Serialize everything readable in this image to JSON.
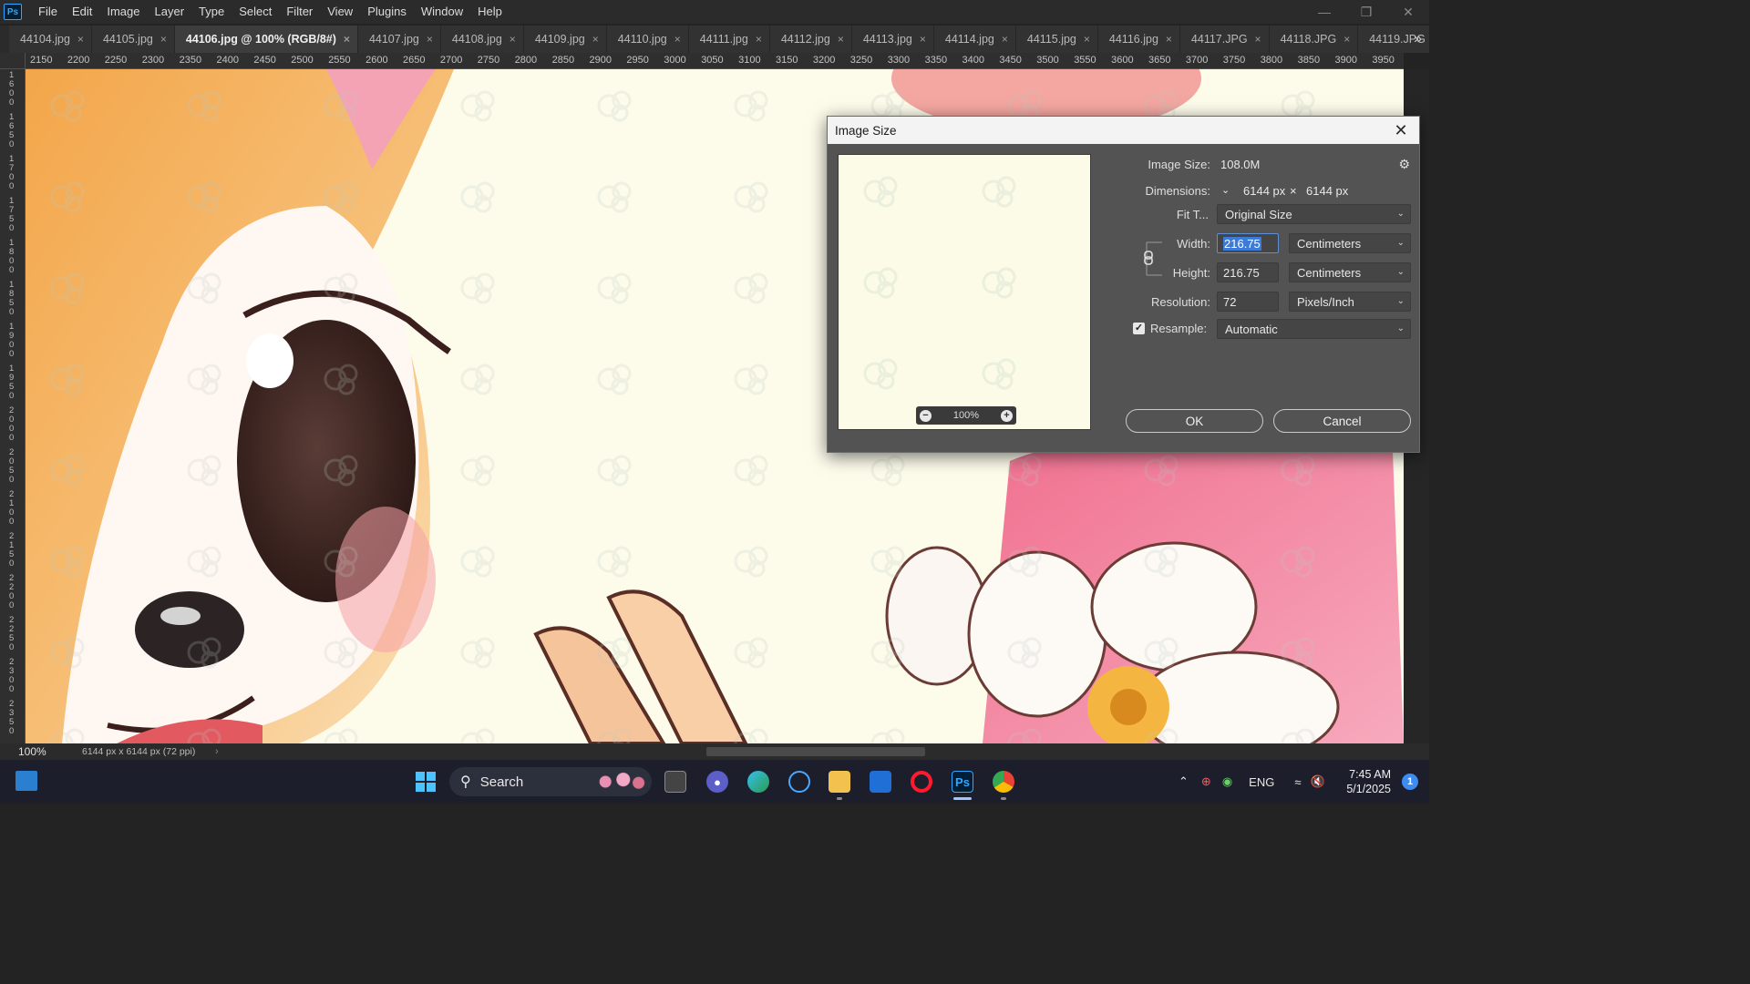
{
  "app": {
    "logo": "Ps"
  },
  "menu": [
    "File",
    "Edit",
    "Image",
    "Layer",
    "Type",
    "Select",
    "Filter",
    "View",
    "Plugins",
    "Window",
    "Help"
  ],
  "window_controls": {
    "minimize": "—",
    "restore": "❐",
    "close": "✕"
  },
  "tabs": [
    {
      "label": "44104.jpg",
      "active": false
    },
    {
      "label": "44105.jpg",
      "active": false
    },
    {
      "label": "44106.jpg @ 100% (RGB/8#)",
      "active": true
    },
    {
      "label": "44107.jpg",
      "active": false
    },
    {
      "label": "44108.jpg",
      "active": false
    },
    {
      "label": "44109.jpg",
      "active": false
    },
    {
      "label": "44110.jpg",
      "active": false
    },
    {
      "label": "44111.jpg",
      "active": false
    },
    {
      "label": "44112.jpg",
      "active": false
    },
    {
      "label": "44113.jpg",
      "active": false
    },
    {
      "label": "44114.jpg",
      "active": false
    },
    {
      "label": "44115.jpg",
      "active": false
    },
    {
      "label": "44116.jpg",
      "active": false
    },
    {
      "label": "44117.JPG",
      "active": false
    },
    {
      "label": "44118.JPG",
      "active": false
    },
    {
      "label": "44119.JPG",
      "active": false
    }
  ],
  "tab_close_glyph": "×",
  "tab_overflow_glyph": "»",
  "ruler_top": [
    "2150",
    "2200",
    "2250",
    "2300",
    "2350",
    "2400",
    "2450",
    "2500",
    "2550",
    "2600",
    "2650",
    "2700",
    "2750",
    "2800",
    "2850",
    "2900",
    "2950",
    "3000",
    "3050",
    "3100",
    "3150",
    "3200",
    "3250",
    "3300",
    "3350",
    "3400",
    "3450",
    "3500",
    "3550",
    "3600",
    "3650",
    "3700",
    "3750",
    "3800",
    "3850",
    "3900",
    "3950"
  ],
  "ruler_left": [
    "1600",
    "1650",
    "1700",
    "1750",
    "1800",
    "1850",
    "1900",
    "1950",
    "2000",
    "2050",
    "2100",
    "2150",
    "2200",
    "2250",
    "2300",
    "2350"
  ],
  "status": {
    "zoom": "100%",
    "doc_info": "6144 px x 6144 px (72 ppi)",
    "arrow": "›"
  },
  "dialog": {
    "title": "Image Size",
    "close_glyph": "✕",
    "gear_glyph": "⚙",
    "preview_zoom": "100%",
    "image_size_label": "Image Size:",
    "image_size_value": "108.0M",
    "dimensions_label": "Dimensions:",
    "dimensions_width": "6144 px",
    "dimensions_times": "×",
    "dimensions_height": "6144 px",
    "fit_to_label": "Fit T...",
    "fit_to_value": "Original Size",
    "width_label": "Width:",
    "width_value": "216.75",
    "width_unit": "Centimeters",
    "height_label": "Height:",
    "height_value": "216.75",
    "height_unit": "Centimeters",
    "resolution_label": "Resolution:",
    "resolution_value": "72",
    "resolution_unit": "Pixels/Inch",
    "resample_label": "Resample:",
    "resample_checked": true,
    "resample_value": "Automatic",
    "ok_label": "OK",
    "cancel_label": "Cancel"
  },
  "taskbar": {
    "search_label": "Search",
    "tray_lang": "ENG",
    "time": "7:45 AM",
    "date": "5/1/2025",
    "notifications": "1",
    "icons": [
      "widgets-icon",
      "start-icon",
      "task-view-icon",
      "teams-icon",
      "edge-icon",
      "snipping-icon",
      "file-explorer-icon",
      "store-icon",
      "opera-icon",
      "photoshop-icon",
      "chrome-icon"
    ]
  },
  "colors": {
    "accent": "#31a8ff",
    "canvas_bg": "#fdfbea",
    "dialog_bg": "#535353",
    "selection": "#3d7bd9"
  }
}
